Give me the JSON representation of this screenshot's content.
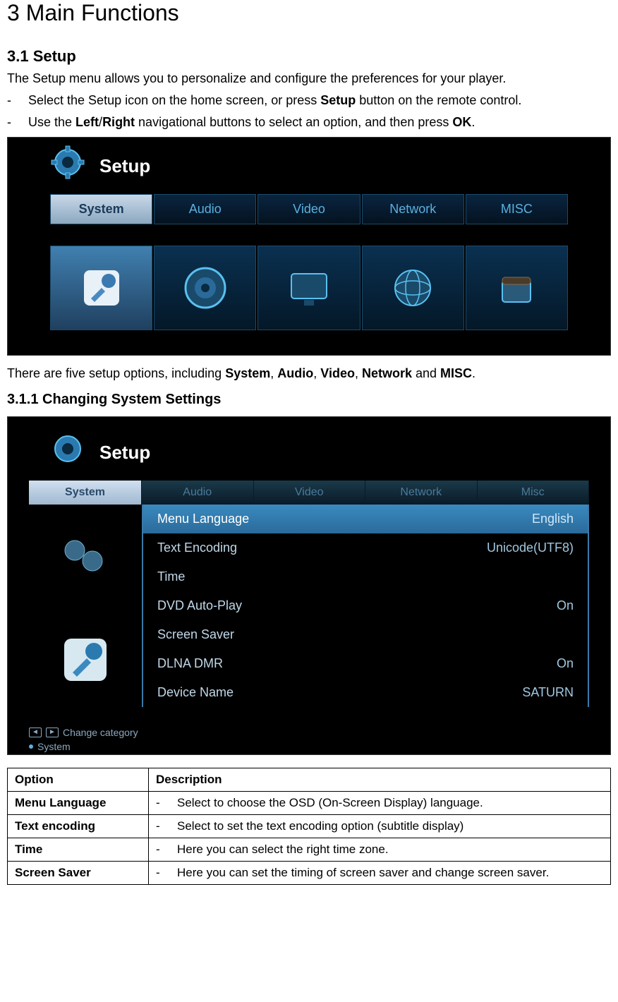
{
  "page_title": "3  Main Functions",
  "section_3_1": "3.1 Setup",
  "intro": "The Setup menu allows you to personalize and configure the preferences for your player.",
  "bullet1_pre": "Select the Setup icon on the home screen, or press ",
  "bullet1_bold": "Setup",
  "bullet1_post": " button on the remote control.",
  "bullet2_pre": "Use the ",
  "bullet2_bold1": "Left",
  "bullet2_slash": "/",
  "bullet2_bold2": "Right",
  "bullet2_mid": " navigational buttons to select an option, and then press ",
  "bullet2_bold3": "OK",
  "bullet2_post": ".",
  "ss1": {
    "title": "Setup",
    "tabs": [
      "System",
      "Audio",
      "Video",
      "Network",
      "MISC"
    ]
  },
  "caption_pre": "There are five setup options, including ",
  "caption_b1": "System",
  "caption_c1": ", ",
  "caption_b2": "Audio",
  "caption_c2": ", ",
  "caption_b3": "Video",
  "caption_c3": ", ",
  "caption_b4": "Network",
  "caption_c4": " and ",
  "caption_b5": "MISC",
  "caption_post": ".",
  "subsection": "3.1.1 Changing System Settings",
  "ss2": {
    "title": "Setup",
    "tabs": [
      "System",
      "Audio",
      "Video",
      "Network",
      "Misc"
    ],
    "rows": [
      {
        "label": "Menu Language",
        "value": "English"
      },
      {
        "label": "Text Encoding",
        "value": "Unicode(UTF8)"
      },
      {
        "label": "Time",
        "value": ""
      },
      {
        "label": "DVD Auto-Play",
        "value": "On"
      },
      {
        "label": "Screen Saver",
        "value": ""
      },
      {
        "label": "DLNA DMR",
        "value": "On"
      },
      {
        "label": "Device Name",
        "value": "SATURN"
      }
    ],
    "footer_hint": "Change category",
    "footer_crumb": "System"
  },
  "table": {
    "header_option": "Option",
    "header_desc": "Description",
    "rows": [
      {
        "option": "Menu Language",
        "desc": "Select to choose the OSD (On-Screen Display) language."
      },
      {
        "option": "Text encoding",
        "desc": "Select to set the text encoding option (subtitle display)"
      },
      {
        "option": "Time",
        "desc": "Here you can select the right time zone."
      },
      {
        "option": "Screen Saver",
        "desc": "Here you can set the timing of screen saver and change screen saver."
      }
    ]
  }
}
